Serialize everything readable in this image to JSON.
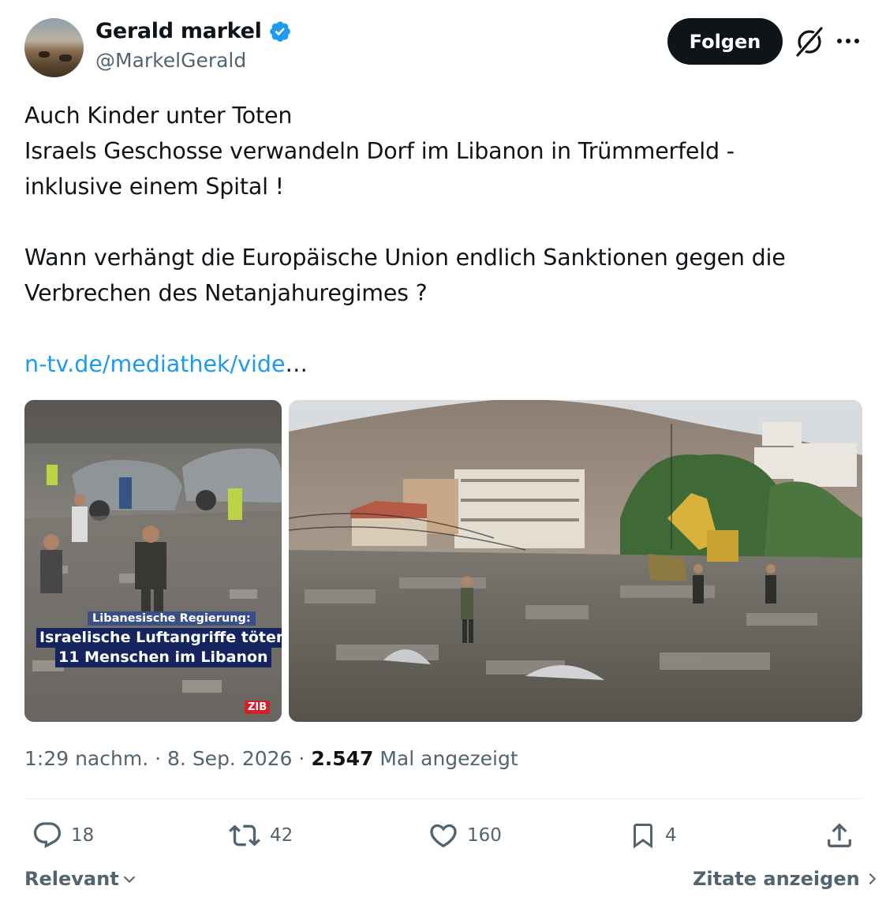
{
  "author": {
    "display_name": "Gerald markel",
    "handle": "@MarkelGerald",
    "verified": true,
    "verified_color": "#1d9bf0"
  },
  "header": {
    "follow_label": "Folgen",
    "grok_icon": "grok-icon",
    "more_icon": "more-icon"
  },
  "tweet": {
    "text": "Auch Kinder unter Toten\nIsraels Geschosse verwandeln Dorf im Libanon in Trümmerfeld -\ninklusive einem Spital !\n\nWann verhängt die Europäische Union endlich Sanktionen gegen die\nVerbrechen des Netanjahuregimes ?",
    "link_text": "n-tv.de/mediathek/vide",
    "link_ellipsis": "…",
    "link_color": "#1d9bf0"
  },
  "media": [
    {
      "caption_top": "Libanesische Regierung:",
      "caption_line1": "Israelische Luftangriffe töten",
      "caption_line2": "11 Menschen im Libanon",
      "badge": "ZIB"
    },
    {}
  ],
  "meta": {
    "time": "1:29 nachm.",
    "separator": "·",
    "date": "8. Sep. 2026",
    "views": "2.547",
    "views_label": "Mal angezeigt"
  },
  "actions": {
    "replies": "18",
    "retweets": "42",
    "likes": "160",
    "bookmarks": "4"
  },
  "footer": {
    "sort_label": "Relevant",
    "quotes_label": "Zitate anzeigen"
  }
}
